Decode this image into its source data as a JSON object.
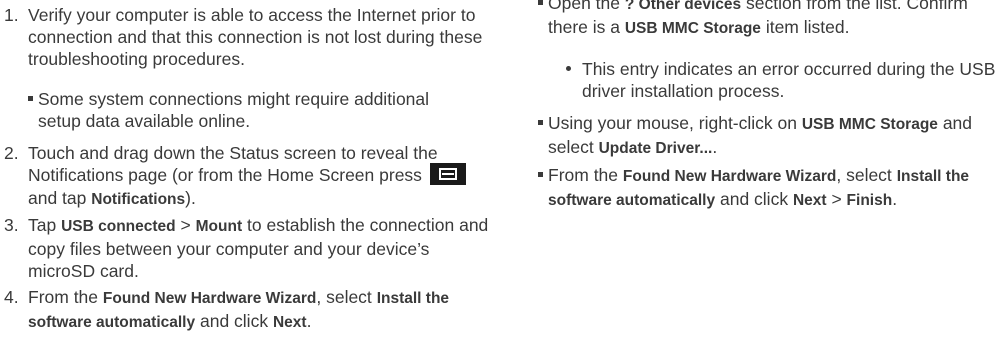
{
  "left": {
    "step1": {
      "num": "1.",
      "text": "Verify your computer is able to access the Internet prior to connection and that this connection is not lost during these troubleshooting procedures.",
      "sub": "Some system connections might require additional setup data available online."
    },
    "step2": {
      "num": "2.",
      "text_a": "Touch and drag down the Status screen to reveal the Notifications page (or from the Home Screen press",
      "text_b": "and tap",
      "notifications": "Notifications",
      "end": ")."
    },
    "step3": {
      "num": "3.",
      "tap": "Tap",
      "usb_connected": "USB connected",
      "gt": ">",
      "mount": "Mount",
      "text": "to establish the connection and copy files between your computer and your device’s microSD card."
    },
    "step4": {
      "num": "4.",
      "from": "From the",
      "wizard": "Found New Hardware Wizard",
      "select": ", select",
      "install": "Install the software automatically",
      "and_click": "and click",
      "next": "Next",
      "end": "."
    }
  },
  "right": {
    "b1": {
      "text_a": "Open the",
      "other": "? Other devices",
      "text_b": "section from the list. Confirm there is a",
      "usbmmc": "USB MMC Storage",
      "text_c": "item listed."
    },
    "b1_sub": "This entry indicates an error occurred during the USB driver installation process.",
    "b2": {
      "text_a": "Using your mouse, right-click on",
      "usbmmc": "USB MMC Storage",
      "text_b": "and select",
      "update": "Update Driver...",
      "end": "."
    },
    "b3": {
      "from": "From the",
      "wizard": "Found New Hardware Wizard",
      "select": ", select",
      "install": "Install the software automatically",
      "and_click": "and click",
      "next": "Next",
      "gt": ">",
      "finish": "Finish",
      "end": "."
    }
  },
  "icons": {
    "menu_key": "menu-key-icon"
  },
  "colors": {
    "text": "#3a3a3a",
    "icon_bg": "#1a1a1a"
  }
}
